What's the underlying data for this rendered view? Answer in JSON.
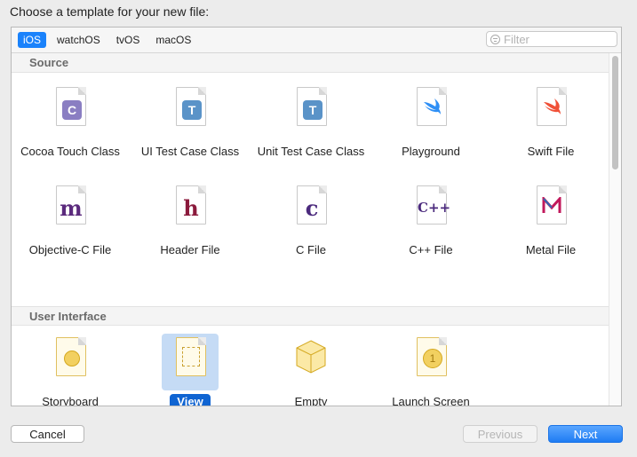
{
  "prompt": "Choose a template for your new file:",
  "tabs": [
    {
      "label": "iOS",
      "active": true
    },
    {
      "label": "watchOS",
      "active": false
    },
    {
      "label": "tvOS",
      "active": false
    },
    {
      "label": "macOS",
      "active": false
    }
  ],
  "filter": {
    "placeholder": "Filter"
  },
  "sections": [
    {
      "title": "Source"
    },
    {
      "title": "User Interface"
    }
  ],
  "source_templates": [
    {
      "label": "Cocoa Touch Class",
      "icon": "cocoa-touch-class-icon",
      "glyph": "C",
      "color": "#8a7ec2"
    },
    {
      "label": "UI Test Case Class",
      "icon": "ui-test-case-class-icon",
      "glyph": "T",
      "color": "#5a93c8"
    },
    {
      "label": "Unit Test Case Class",
      "icon": "unit-test-case-class-icon",
      "glyph": "T",
      "color": "#5a93c8"
    },
    {
      "label": "Playground",
      "icon": "playground-swift-icon",
      "glyph": "swift",
      "color": "#2f8ff5"
    },
    {
      "label": "Swift File",
      "icon": "swift-file-icon",
      "glyph": "swift",
      "color": "#f05138"
    },
    {
      "label": "Objective-C File",
      "icon": "objective-c-file-icon",
      "glyph": "m",
      "color": "#5b2a7d"
    },
    {
      "label": "Header File",
      "icon": "header-file-icon",
      "glyph": "h",
      "color": "#8b1a3c"
    },
    {
      "label": "C File",
      "icon": "c-file-icon",
      "glyph": "c",
      "color": "#4b2a7d"
    },
    {
      "label": "C++ File",
      "icon": "cpp-file-icon",
      "glyph": "C++",
      "color": "#4b2a7d"
    },
    {
      "label": "Metal File",
      "icon": "metal-file-icon",
      "glyph": "metal",
      "color": "#c2185b"
    }
  ],
  "ui_templates": [
    {
      "label": "Storyboard",
      "icon": "storyboard-icon",
      "selected": false
    },
    {
      "label": "View",
      "icon": "view-icon",
      "selected": true
    },
    {
      "label": "Empty",
      "icon": "empty-icon",
      "selected": false
    },
    {
      "label": "Launch Screen",
      "icon": "launch-screen-icon",
      "glyph": "1",
      "selected": false
    }
  ],
  "buttons": {
    "cancel": "Cancel",
    "previous": "Previous",
    "next": "Next"
  }
}
